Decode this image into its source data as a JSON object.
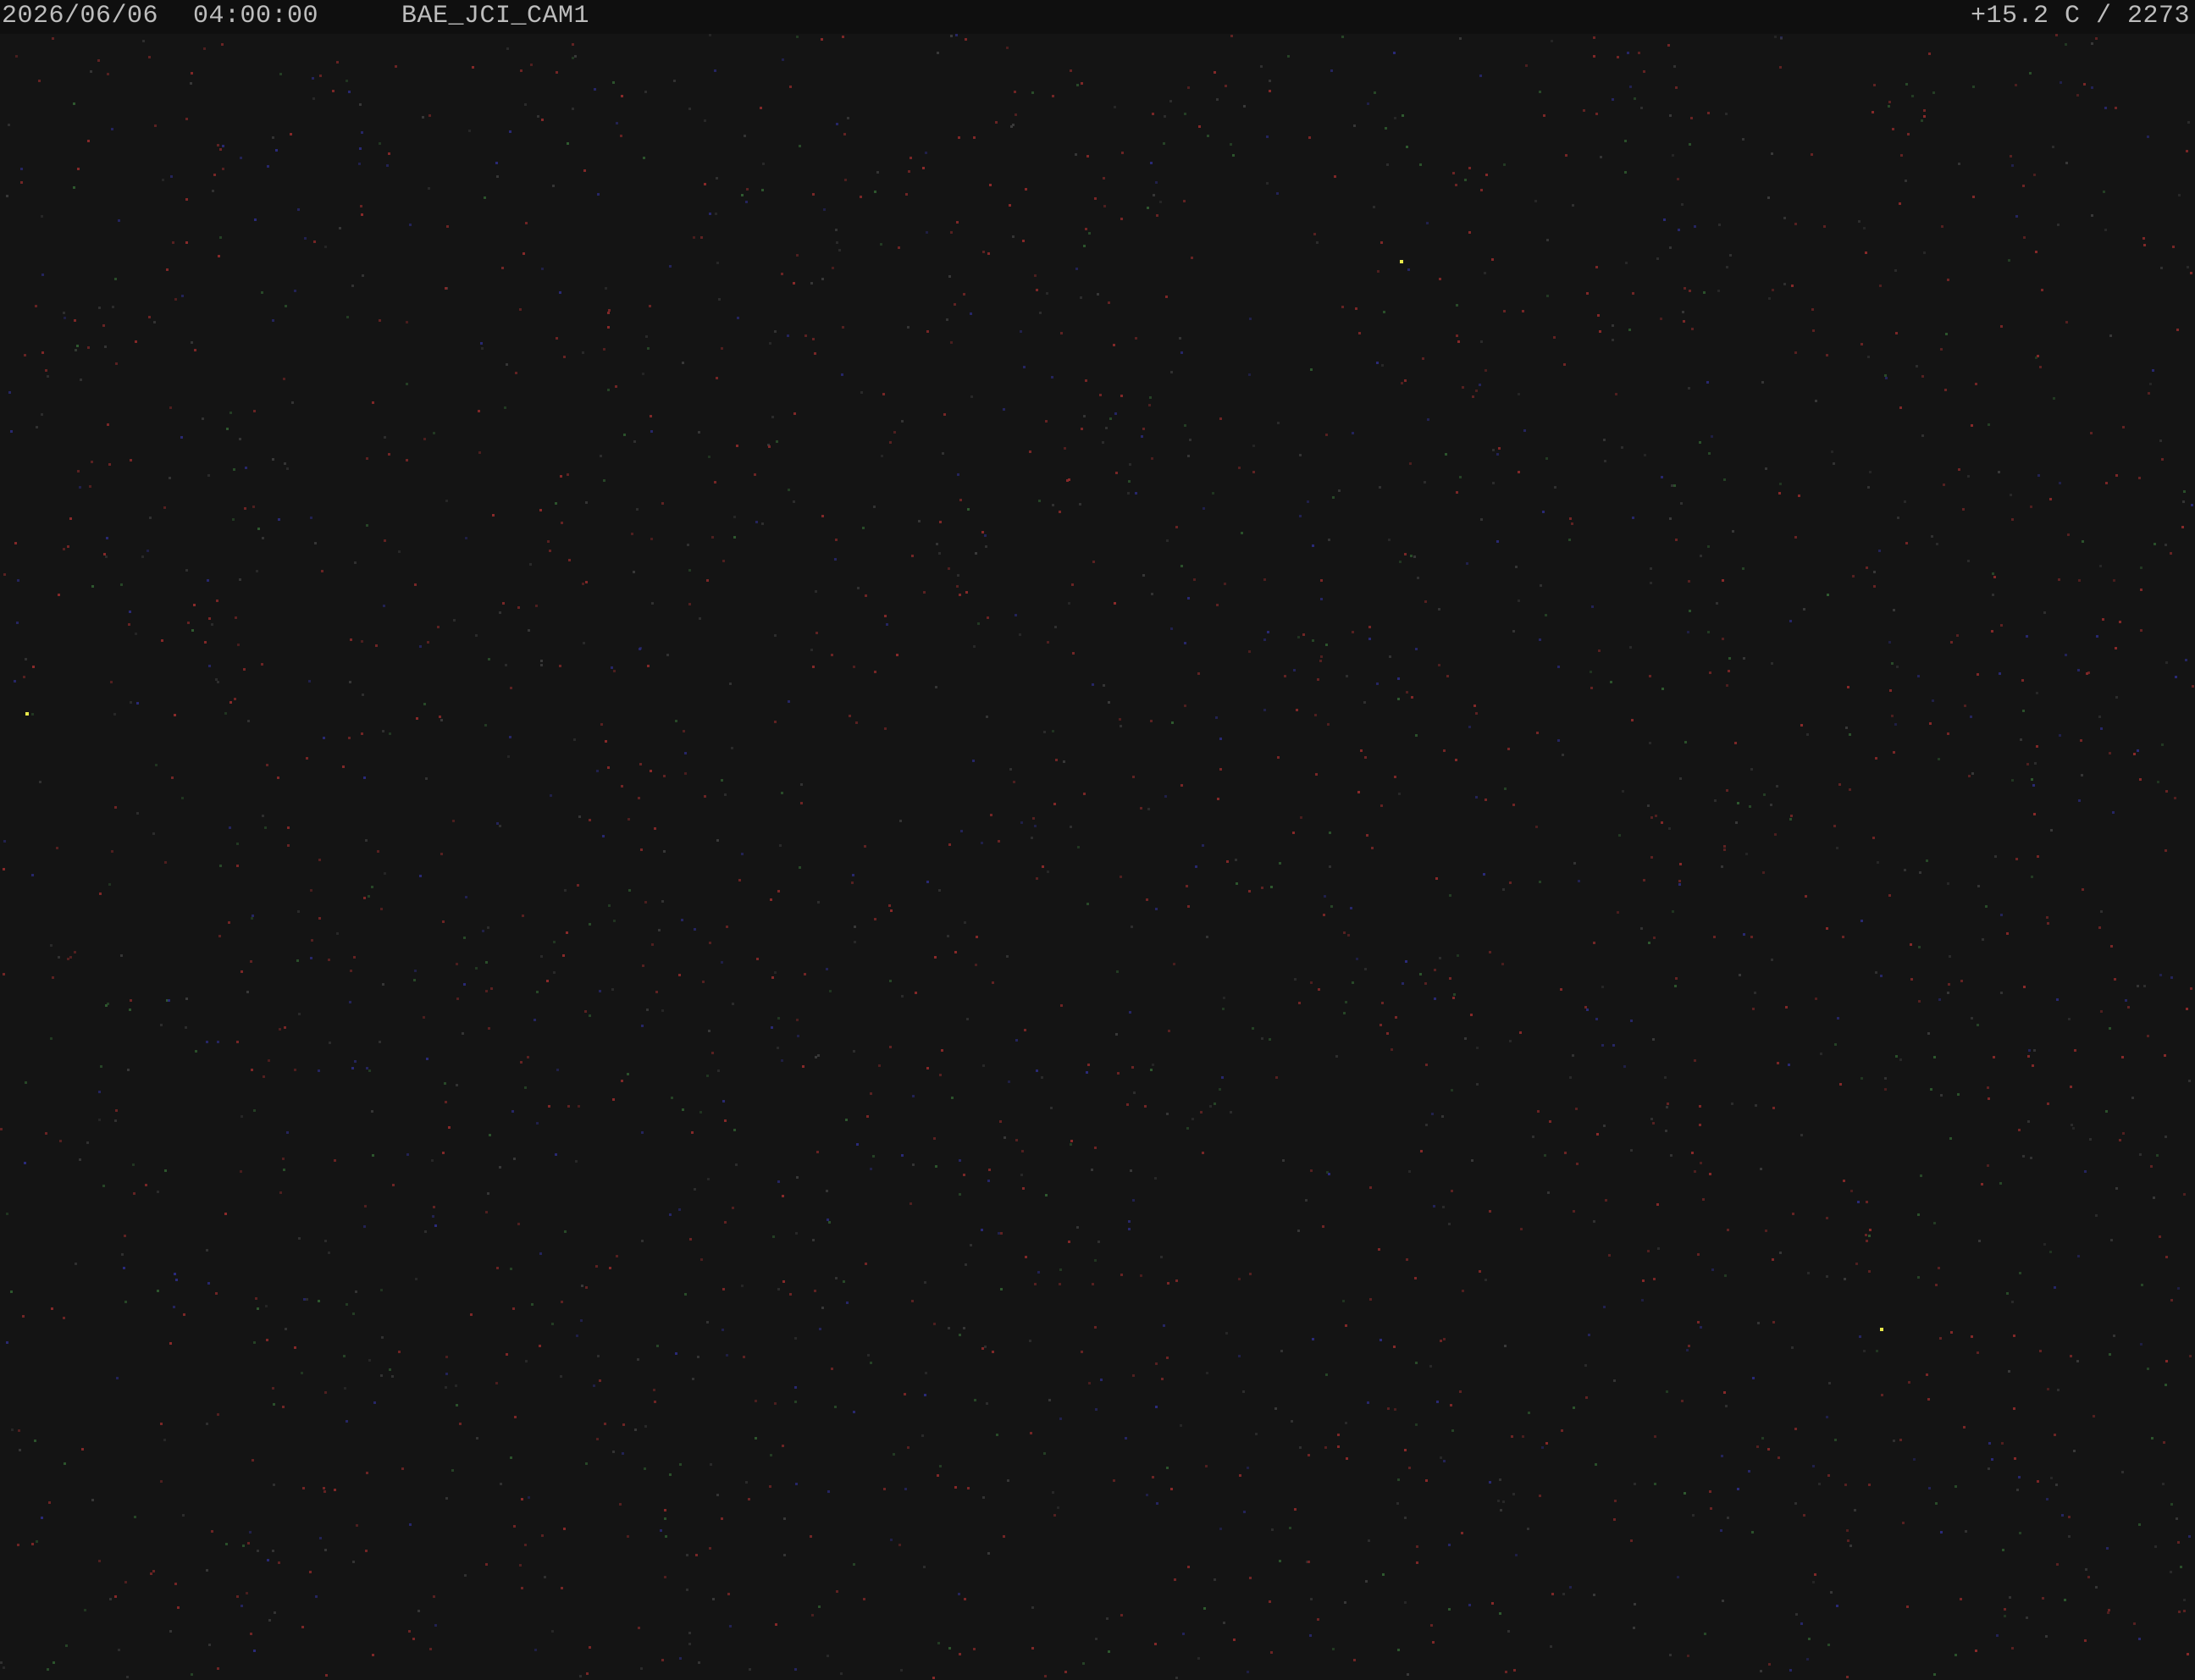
{
  "overlay": {
    "date": "2026/06/06",
    "time": "04:00:00",
    "camera_id": "BAE_JCI_CAM1",
    "temperature": "+15.2 C / 2273"
  },
  "colors": {
    "background": "#141414",
    "overlay_text": "#bdbdbd",
    "overlay_bar": "#0f0f0f",
    "noise_red": "#8a2a2a",
    "noise_green": "#2f5a2f",
    "noise_blue": "#2b2b7a",
    "noise_gray": "#3a3a3a",
    "highlight_yellow": "#e8e84a"
  },
  "noise": {
    "description": "sensor hot-pixel noise over dark sky",
    "density": 2600
  }
}
